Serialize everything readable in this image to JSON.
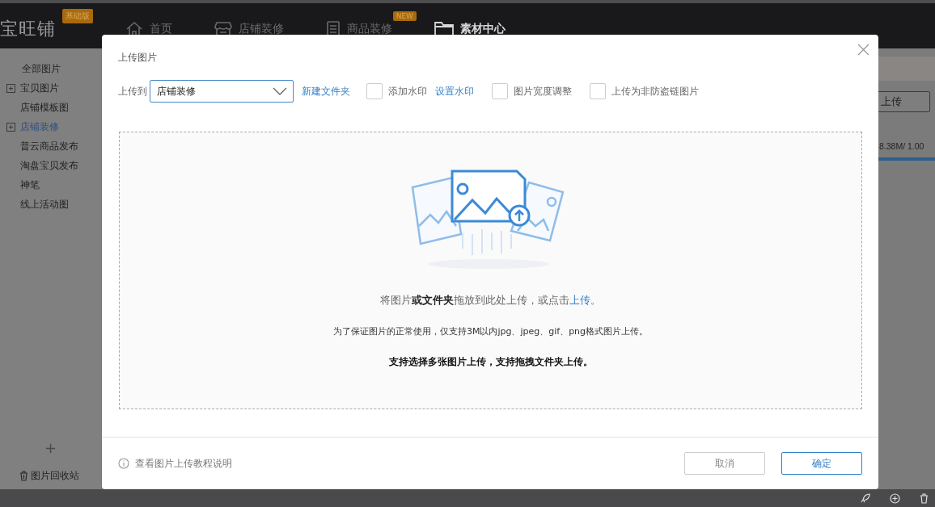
{
  "app": {
    "logo": "宝旺铺",
    "edition_badge": "基础版",
    "nav": [
      {
        "label": "首页",
        "selected": false
      },
      {
        "label": "店铺装修",
        "selected": false
      },
      {
        "label": "商品装修",
        "selected": false,
        "badge": "NEW"
      },
      {
        "label": "素材中心",
        "selected": true
      }
    ]
  },
  "sidebar": {
    "items": [
      {
        "label": "全部图片",
        "selected": false,
        "has_subfolders": false,
        "children": [
          {
            "label": "宝贝图片",
            "selected": false,
            "has_subfolders": true
          },
          {
            "label": "店铺模板图",
            "selected": false,
            "has_subfolders": false
          },
          {
            "label": "店铺装修",
            "selected": true,
            "has_subfolders": true
          },
          {
            "label": "普云商品发布",
            "selected": false,
            "has_subfolders": false
          },
          {
            "label": "淘盘宝贝发布",
            "selected": false,
            "has_subfolders": false
          },
          {
            "label": "神笔",
            "selected": false,
            "has_subfolders": false
          },
          {
            "label": "线上活动图",
            "selected": false,
            "has_subfolders": false
          }
        ]
      }
    ],
    "add_button": "+",
    "recycle_bin": "图片回收站"
  },
  "background_panel": {
    "upload_button": "上传",
    "storage_text": "8.38M/ 1.00"
  },
  "dialog": {
    "title": "上传图片",
    "upload_to_label": "上传到",
    "folder_select": {
      "value": "店铺装修"
    },
    "new_folder_link": "新建文件夹",
    "options": [
      {
        "label": "添加水印",
        "checked": false,
        "link": "设置水印"
      },
      {
        "label": "图片宽度调整",
        "checked": false
      },
      {
        "label": "上传为非防盗链图片",
        "checked": false
      }
    ],
    "dropzone": {
      "hint": {
        "text_before": "将图片**或文件夹**拖放到此处上传，或点击",
        "link": "上传",
        "text_after": "。"
      },
      "note": "为了保证图片的正常使用，仅支持3M以内jpg、jpeg、gif、png格式图片上传。",
      "tip": "支持选择多张图片上传，支持拖拽文件夹上传。"
    },
    "help_link": "查看图片上传教程说明",
    "buttons": [
      {
        "label": "取消",
        "kind": "secondary"
      },
      {
        "label": "确定",
        "kind": "primary"
      }
    ]
  }
}
